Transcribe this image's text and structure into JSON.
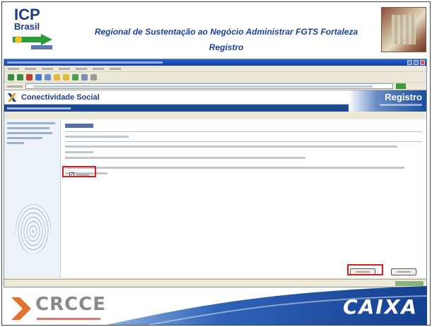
{
  "header": {
    "logo_icp_line1": "ICP",
    "logo_icp_line2": "Brasil",
    "title_line1": "Regional de Sustentação ao Negócio Administrar FGTS  Fortaleza",
    "title_line2": "Registro"
  },
  "screenshot": {
    "site_name": "Conectividade Social",
    "site_banner": "Registro",
    "checkbox_checked": true
  },
  "footer": {
    "crcce_logo": "CRCCE",
    "caixa_logo": "CAIXA"
  },
  "colors": {
    "title_blue": "#1a3fa8",
    "highlight_red": "#e01b1b",
    "caixa_blue": "#1f4f9f",
    "crcce_orange": "#e2702e"
  },
  "icons": {
    "conectividade_logo": "x-logo-icon",
    "fingerprint": "fingerprint-icon",
    "crcce_chevron": "chevron-right-icon"
  }
}
